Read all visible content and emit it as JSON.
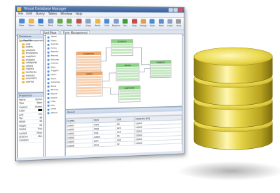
{
  "window": {
    "title": "Visual Database Manager",
    "menu": [
      "File",
      "Edit",
      "Query",
      "Tables",
      "Window",
      "Help"
    ],
    "toolbar_buttons": [
      {
        "label": "New",
        "color": "#4b8bd6"
      },
      {
        "label": "Open",
        "color": "#e8b84a"
      },
      {
        "label": "Save",
        "color": "#3a7ccf"
      },
      {
        "label": "Print",
        "color": "#8ba3c2"
      },
      {
        "label": "Undo",
        "color": "#6aa84f"
      },
      {
        "label": "Redo",
        "color": "#6aa84f"
      },
      {
        "label": "Cut",
        "color": "#c0504d"
      },
      {
        "label": "Copy",
        "color": "#8ba3c2"
      },
      {
        "label": "Paste",
        "color": "#e8b84a"
      },
      {
        "label": "Find",
        "color": "#4b8bd6"
      },
      {
        "label": "Replace",
        "color": "#7a9ccf"
      },
      {
        "label": "Run",
        "color": "#3c9b3c"
      },
      {
        "label": "Stop",
        "color": "#c0504d"
      },
      {
        "label": "Design",
        "color": "#e59c4a"
      },
      {
        "label": "Data",
        "color": "#4b8bd6"
      },
      {
        "label": "Table",
        "color": "#5c8fd0"
      },
      {
        "label": "Index",
        "color": "#8ba3c2"
      },
      {
        "label": "Tools",
        "color": "#9b9b9b"
      }
    ],
    "tabs": [
      "Start Page",
      "Form Management"
    ]
  },
  "explorer": {
    "header": "Database Navigator",
    "items": [
      "Form Management",
      "cust",
      "orders",
      "products",
      "employees",
      "suppliers",
      "shippers",
      "categories",
      "details",
      "regions",
      "territories",
      "invoices",
      "payments",
      "queries"
    ]
  },
  "properties": {
    "header": "Properties",
    "rows": [
      {
        "name": "Name",
        "value": "tblOrd"
      },
      {
        "name": "Type",
        "value": "Table"
      },
      {
        "name": "Caption",
        "value": "Orders"
      },
      {
        "name": "Color",
        "value": ""
      },
      {
        "name": "Left",
        "value": "120"
      },
      {
        "name": "Top",
        "value": "48"
      },
      {
        "name": "Width",
        "value": "96"
      },
      {
        "name": "Height",
        "value": "64"
      },
      {
        "name": "Visible",
        "value": "True"
      },
      {
        "name": "Locked",
        "value": "False"
      },
      {
        "name": "Schema",
        "value": "dbo"
      },
      {
        "name": "Collation",
        "value": ""
      }
    ]
  },
  "objects": {
    "items": [
      "Tables",
      "Views",
      "Queries",
      "Forms",
      "Reports",
      "Macros",
      "Modules",
      "Indexes",
      "Keys",
      "Triggers",
      "Users",
      "Roles",
      "Schemas",
      "Procs",
      "Backup",
      "Export",
      "Import",
      "Logs",
      "Jobs",
      "Links",
      "Search"
    ]
  },
  "designer": {
    "entities": [
      {
        "name": "customers",
        "color": "#f0a86b"
      },
      {
        "name": "orders",
        "color": "#f0a86b"
      },
      {
        "name": "products",
        "color": "#8fd18a"
      },
      {
        "name": "details",
        "color": "#8fd18a"
      },
      {
        "name": "payments",
        "color": "#8fd18a"
      },
      {
        "name": "shippers",
        "color": "#8fd18a"
      }
    ]
  },
  "grid": {
    "header": "Result",
    "columns": [
      "id [PK]",
      "item",
      "cost",
      "ORDERid [FK]"
    ],
    "rows": [
      [
        "20001",
        "cord",
        "30",
        "10001"
      ],
      [
        "20002",
        "mod",
        "225",
        "10002"
      ],
      [
        "20003",
        "hub",
        "110",
        "10001"
      ],
      [
        "20004",
        "cable",
        "25",
        "10003"
      ],
      [
        "20005",
        "port",
        "140",
        "10002"
      ],
      [
        "20006",
        "plug",
        "12",
        "10004"
      ]
    ]
  },
  "colors": {
    "title_bar": "#3a5f98",
    "db_gold": "#d9c53a",
    "db_highlight": "#fff7b0",
    "db_shadow": "#8a7a12"
  }
}
